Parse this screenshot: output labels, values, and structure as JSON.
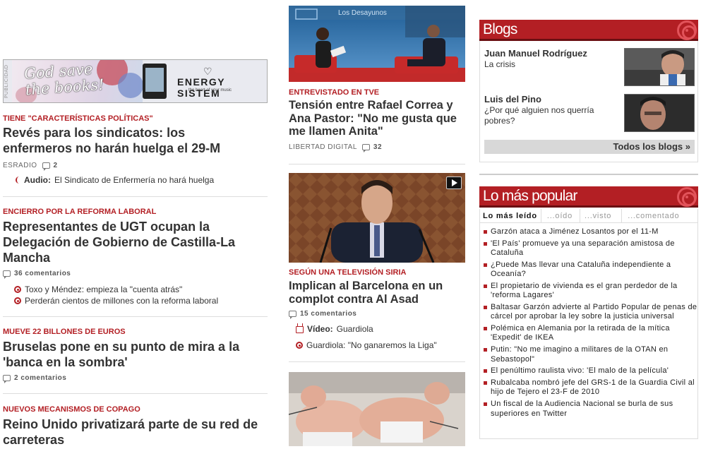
{
  "ad": {
    "vertical_label": "PUBLICIDAD",
    "headline": "God save the books!",
    "brand": "ENERGY SISTEM",
    "tagline": "the heart of your music"
  },
  "left": {
    "articles": [
      {
        "kicker": "TIENE \"CARACTERÍSTICAS POLÍTICAS\"",
        "headline": "Revés para los sindicatos: los enfermeros no harán huelga el 29-M",
        "source": "ESRADIO",
        "comments": "2",
        "related": [
          {
            "prefix": "Audio:",
            "text": "El Sindicato de Enfermería no hará huelga"
          }
        ]
      },
      {
        "kicker": "ENCIERRO POR LA REFORMA LABORAL",
        "headline": "Representantes de UGT ocupan la Delegación de Gobierno de Castilla-La Mancha",
        "comments": "36 comentarios",
        "related": [
          {
            "text": "Toxo y Méndez: empieza la \"cuenta atrás\""
          },
          {
            "text": "Perderán cientos de millones con la reforma laboral"
          }
        ]
      },
      {
        "kicker": "MUEVE 22 BILLONES DE EUROS",
        "headline": "Bruselas pone en su punto de mira a la 'banca en la sombra'",
        "comments": "2 comentarios"
      },
      {
        "kicker": "NUEVOS MECANISMOS DE COPAGO",
        "headline": "Reino Unido privatizará parte de su red de carreteras"
      }
    ]
  },
  "middle": {
    "photo1_caption": "Los Desayunos",
    "articles": [
      {
        "kicker": "ENTREVISTADO EN TVE",
        "headline": "Tensión entre Rafael Correa y Ana Pastor: \"No me gusta que me llamen Anita\"",
        "source": "LIBERTAD DIGITAL",
        "comments": "32"
      },
      {
        "kicker": "SEGÚN UNA TELEVISIÓN SIRIA",
        "headline": "Implican al Barcelona en un complot contra Al Asad",
        "comments": "15 comentarios",
        "related": [
          {
            "prefix": "Vídeo:",
            "text": "Guardiola"
          },
          {
            "text": "Guardiola: \"No ganaremos la Liga\""
          }
        ]
      }
    ]
  },
  "right": {
    "blogs": {
      "title": "Blogs",
      "items": [
        {
          "author": "Juan Manuel Rodríguez",
          "post": "La crisis"
        },
        {
          "author": "Luis del Pino",
          "post": "¿Por qué alguien nos querría pobres?"
        }
      ],
      "all_link": "Todos los blogs »"
    },
    "popular": {
      "title": "Lo más popular",
      "tabs": [
        "Lo más leído",
        "...oído",
        "...visto",
        "...comentado"
      ],
      "items": [
        "Garzón ataca a Jiménez Losantos por el 11-M",
        "'El País' promueve ya una separación amistosa de Cataluña",
        "¿Puede Mas llevar una Cataluña independiente a Oceanía?",
        "El propietario de vivienda es el gran perdedor de la 'reforma Lagares'",
        "Baltasar Garzón advierte al Partido Popular de penas de cárcel por aprobar la ley sobre la justicia universal",
        "Polémica en Alemania por la retirada de la mítica 'Expedit' de IKEA",
        "Putin: \"No me imagino a militares de la OTAN en Sebastopol\"",
        "El penúltimo raulista vivo: 'El malo de la película'",
        "Rubalcaba nombró jefe del GRS-1 de la Guardia Civil al hijo de Tejero el 23-F de 2010",
        "Un fiscal de la Audiencia Nacional se burla de sus superiores en Twitter"
      ]
    }
  },
  "colors": {
    "accent": "#b31f24",
    "accent_dark": "#6a0f12",
    "text": "#333333"
  }
}
